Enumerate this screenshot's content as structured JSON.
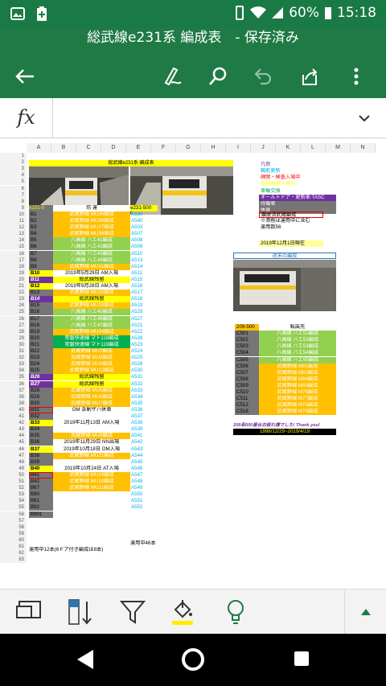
{
  "status": {
    "battery": "60%",
    "time": "15:18"
  },
  "title": "総武線e231系 編成表　- 保存済み",
  "formula": {
    "fx": "fx",
    "value": ""
  },
  "columns": [
    "A",
    "B",
    "C",
    "D",
    "E",
    "F",
    "G",
    "H",
    "I",
    "J",
    "K",
    "L",
    "M",
    "N"
  ],
  "sheet": {
    "header_title": "総武線e231系 編成表",
    "left_header": [
      "e231-0",
      "坊  運",
      "e231-500"
    ],
    "rows_left": [
      {
        "id": "B1",
        "desc": "武蔵野線 MU36編成",
        "code": "A520",
        "style": "o"
      },
      {
        "id": "B2",
        "desc": "武蔵野線 MU36編成",
        "code": "A540",
        "style": "o"
      },
      {
        "id": "B3",
        "desc": "武蔵野線 MU37編成",
        "code": "A503",
        "style": "o"
      },
      {
        "id": "B4",
        "desc": "武蔵野線 MU38編成",
        "code": "A507",
        "style": "o"
      },
      {
        "id": "B5",
        "desc": "八高線 ハエ41編成",
        "code": "A508",
        "style": "gr"
      },
      {
        "id": "B6",
        "desc": "八高線 ハエ42編成",
        "code": "A509",
        "style": "gr"
      },
      {
        "id": "B7",
        "desc": "八高線 ハエ43編成",
        "code": "A510",
        "style": "gr"
      },
      {
        "id": "B8",
        "desc": "八高線 ハエ44編成",
        "code": "A513",
        "style": "gr"
      },
      {
        "id": "B9",
        "desc": "武蔵野線 MU31編成",
        "code": "A514",
        "style": "o"
      },
      {
        "id": "B10",
        "desc": "2019年5月29日 AM入場",
        "code": "A511",
        "style": "w"
      },
      {
        "id": "B11",
        "desc": "総武線残留",
        "code": "A515",
        "style": "y"
      },
      {
        "id": "B12",
        "desc": "2019年9月28日 AM入場",
        "code": "A516",
        "style": "w"
      },
      {
        "id": "B13",
        "desc": "武蔵野線 MU32編成",
        "code": "A517",
        "style": "o"
      },
      {
        "id": "B14",
        "desc": "総武線残留",
        "code": "A518",
        "style": "y"
      },
      {
        "id": "B15",
        "desc": "武蔵野線 MU39編成",
        "code": "A519",
        "style": "o"
      },
      {
        "id": "B16",
        "desc": "八高線 ハエ45編成",
        "code": "A529",
        "style": "gr"
      },
      {
        "id": "B17",
        "desc": "八高線 ハエ46編成",
        "code": "A527",
        "style": "gr"
      },
      {
        "id": "B18",
        "desc": "八高線 ハエ47編成",
        "code": "A521",
        "style": "gr"
      },
      {
        "id": "B19",
        "desc": "武蔵野線 MU34編成",
        "code": "A522",
        "style": "o"
      },
      {
        "id": "B20",
        "desc": "常磐快速線 マト118編成",
        "code": "A526",
        "style": "tg"
      },
      {
        "id": "B21",
        "desc": "常磐快速線 マト119編成",
        "code": "A523",
        "style": "tg"
      },
      {
        "id": "B22",
        "desc": "武蔵野線 MU2編成",
        "code": "A524",
        "style": "o"
      },
      {
        "id": "B23",
        "desc": "武蔵野線 MU3編成",
        "code": "A525",
        "style": "o"
      },
      {
        "id": "B24",
        "desc": "武蔵野線 MU4編成",
        "code": "A528",
        "style": "o"
      },
      {
        "id": "B25",
        "desc": "武蔵野線 MU12編成",
        "code": "A530",
        "style": "o"
      },
      {
        "id": "B26",
        "desc": "総武線残留",
        "code": "A531",
        "style": "y"
      },
      {
        "id": "B27",
        "desc": "総武線残留",
        "code": "A532",
        "style": "y"
      },
      {
        "id": "B28",
        "desc": "武蔵野線 MU5編成",
        "code": "A533",
        "style": "o"
      },
      {
        "id": "B29",
        "desc": "武蔵野線 MU6編成",
        "code": "A534",
        "style": "o"
      },
      {
        "id": "B30",
        "desc": "武蔵野線 MU7編成",
        "code": "A535",
        "style": "o"
      },
      {
        "id": "B31",
        "desc": "OM 余剰ザハ休車",
        "code": "A536",
        "style": "w"
      },
      {
        "id": "B32",
        "desc": "",
        "code": "A537",
        "style": "w"
      },
      {
        "id": "B33",
        "desc": "2019年11月13日 AM入場",
        "code": "A539",
        "style": "w"
      },
      {
        "id": "B34",
        "desc": "",
        "code": "A539",
        "style": "w"
      },
      {
        "id": "B35",
        "desc": "武蔵野線 MU9編成",
        "code": "A541",
        "style": "o"
      },
      {
        "id": "B36",
        "desc": "2019年11月29日 NN出場",
        "code": "A542",
        "style": "w"
      },
      {
        "id": "B37",
        "desc": "2019年10月18日 OM入場",
        "code": "A543",
        "style": "w"
      },
      {
        "id": "B38",
        "desc": "武蔵野線 MU21編成",
        "code": "A544",
        "style": "o"
      },
      {
        "id": "B39",
        "desc": "",
        "code": "A545",
        "style": "w"
      },
      {
        "id": "B40",
        "desc": "2019年10月24日 AT入場",
        "code": "A546",
        "style": "w"
      },
      {
        "id": "B41",
        "desc": "武蔵野線 MU19編成",
        "code": "A547",
        "style": "o"
      },
      {
        "id": "B42",
        "desc": "武蔵野線 MU10編成",
        "code": "A548",
        "style": "o"
      },
      {
        "id": "B67",
        "desc": "武蔵野線 MU11編成",
        "code": "A549",
        "style": "o"
      },
      {
        "id": "B80",
        "desc": "",
        "code": "A550",
        "style": "w"
      },
      {
        "id": "B81",
        "desc": "",
        "code": "A551",
        "style": "w"
      },
      {
        "id": "B82",
        "desc": "",
        "code": "A552",
        "style": "w"
      },
      {
        "id": "B901",
        "desc": "",
        "code": "",
        "style": "w"
      }
    ],
    "footer_left": "運用中12本(6ドア付き編成は8本)",
    "footer_mid": "運用中46本",
    "legend": [
      {
        "text": "凡例",
        "color": "#7030a0",
        "bg": "#ffffff"
      },
      {
        "text": "職能更新",
        "color": "#00b0f0",
        "bg": "#ffffff"
      },
      {
        "text": "疎開・検査入場中",
        "color": "#ff0000",
        "bg": "#ffffff"
      },
      {
        "text": "長期廃車入場中",
        "color": "#ffff00",
        "bg": "#ffffff"
      },
      {
        "text": "車輪交換",
        "color": "#00b050",
        "bg": "#ffffff"
      },
      {
        "text": "オールトドア・更新車:TASC",
        "color": "#ffffff",
        "bg": "#7030a0"
      },
      {
        "text": "待機車",
        "color": "#ffffff",
        "bg": "#767676"
      },
      {
        "text": "休車",
        "color": "#ffffff",
        "bg": "#767676"
      }
    ],
    "notes": [
      "離脱済武蔵編成",
      "※添削は運用中に含む",
      "運用数56",
      "2019年12月1日現在"
    ],
    "week_title": "週末の編成",
    "right_header": [
      "209-500",
      "転属先"
    ],
    "rows_right": [
      {
        "id": "C501",
        "desc": "八高線 ハエ51編成",
        "style": "gr"
      },
      {
        "id": "C502",
        "desc": "八高線 ハエ52編成",
        "style": "gr"
      },
      {
        "id": "C503",
        "desc": "八高線 ハエ53編成",
        "style": "gr"
      },
      {
        "id": "C504",
        "desc": "八高線 ハエ54編成",
        "style": "gr"
      },
      {
        "id": "C505",
        "desc": "八高線 ハエ55編成",
        "style": "gr"
      },
      {
        "id": "C506",
        "desc": "武蔵野線 M81編成",
        "style": "o"
      },
      {
        "id": "C507",
        "desc": "武蔵野線 M82編成",
        "style": "o"
      },
      {
        "id": "C508",
        "desc": "武蔵野線 M84編成",
        "style": "o"
      },
      {
        "id": "C509",
        "desc": "武蔵野線 M83編成",
        "style": "o"
      },
      {
        "id": "C510",
        "desc": "武蔵野線 M76編成",
        "style": "o"
      },
      {
        "id": "C511",
        "desc": "武蔵野線 M77編成",
        "style": "o"
      },
      {
        "id": "C512",
        "desc": "武蔵野線 M78編成",
        "style": "o"
      },
      {
        "id": "C518",
        "desc": "武蔵野線 M74編成",
        "style": "o"
      }
    ],
    "thanks": "209系500番台お疲れ様でした! Thank you!",
    "thanks_dates": "1998/12/29~2019/4/19"
  },
  "colors": {
    "header_green": "#1f7a46",
    "status_green": "#1a7a45",
    "accent_yellow": "#ffee00"
  }
}
